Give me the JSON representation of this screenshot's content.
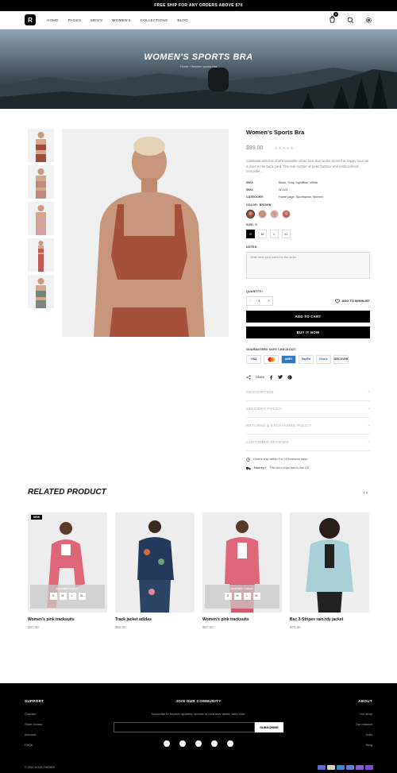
{
  "topbar": {
    "text": "FREE SHIP FOR ANY ORDERS ABOVE $70"
  },
  "nav": {
    "logo": "R",
    "items": [
      "HOME",
      "PAGES",
      "MEN'S",
      "WOMEN'S",
      "COLLECTIONS",
      "BLOG"
    ],
    "cart_count": "0"
  },
  "hero": {
    "title": "WOMEN'S SPORTS BRA",
    "breadcrumb": "Home / Women sports bra"
  },
  "product": {
    "title": "Women's Sports Bra",
    "price": "$99.00",
    "stars": "★★★★★",
    "description": "Captivate with this shirt's versatile urban look that works as well at happy hour as it does in the back yard. The real mother of pearl buttons and embroidered crocodile...",
    "meta": [
      {
        "key": "SKU:",
        "value": "Black, Gray, LightBlue, White"
      },
      {
        "key": "SKU:",
        "value": "W-123"
      },
      {
        "key": "CATEGORY:",
        "value": "Home page, Sportswear, Women"
      }
    ],
    "color_label": "COLOR: BROWN",
    "size_label": "SIZE: S",
    "sizes": [
      "S",
      "M",
      "L",
      "XL"
    ],
    "notes_label": "NOTES:",
    "notes_placeholder": "Write here your notes for the order",
    "quantity_label": "QUANTITY:",
    "quantity": "1",
    "qty_minus": "-",
    "qty_plus": "+",
    "wishlist": "ADD TO WISHLIST",
    "add_to_cart": "ADD TO CART",
    "buy_now": "BUY IT NOW",
    "checkout_label": "GUARANTEED SAFE CHECKOUT:",
    "payments": [
      "VISA",
      "MC",
      "AMEX",
      "PayPal",
      "Diners",
      "DISCOVER"
    ],
    "share": "Share",
    "accordions": [
      "DESCRIPTION",
      "DELIVERY POLICY",
      "RETURNS & EXCHANGES POLICY",
      "CUSTOMER REVIEWS"
    ],
    "ship1": "Orders ship within 5 to 10 business days.",
    "ship2_bold": "Hoorey !",
    "ship2": "This item ships free to the US"
  },
  "related": {
    "title": "RELATED PRODUCT",
    "prev": "‹",
    "next": "›",
    "badge": "NEW",
    "avail_label": "Available Instock",
    "sizes": [
      "S",
      "M",
      "L",
      "XL"
    ],
    "items": [
      {
        "name": "Women's pink tracksuits",
        "price": "$67.00"
      },
      {
        "name": "Track jacket adidas",
        "price": "$54.00"
      },
      {
        "name": "Women's pink tracksuits",
        "price": "$67.00"
      },
      {
        "name": "Bsc 3-Stripes rain.rdy jacket",
        "price": "$75.00"
      }
    ]
  },
  "footer": {
    "support": "SUPPORT",
    "support_links": [
      "Contact",
      "Store locator",
      "Account",
      "FAQs"
    ],
    "community": "JOIN OUR COMMUNITY",
    "community_sub": "Subscribe to receive updates, access to exclusive deals, and more.",
    "subscribe": "SUBSCRIBE",
    "about": "ABOUT",
    "about_links": [
      "Our story",
      "Our mission",
      "Jobs",
      "Blog"
    ],
    "copyright": "© 2021 NOVA THEMES"
  }
}
